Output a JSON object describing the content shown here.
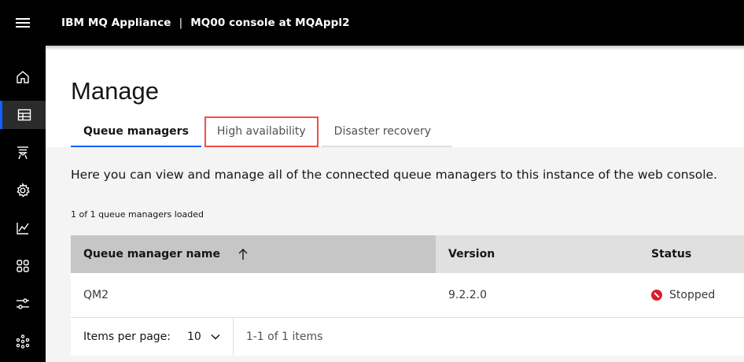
{
  "header": {
    "product": "IBM MQ Appliance",
    "separator": "|",
    "console": "MQ00 console at MQAppl2"
  },
  "sidebar": {
    "items": [
      {
        "icon": "home-icon"
      },
      {
        "icon": "table-icon",
        "active": true
      },
      {
        "icon": "queue-icon"
      },
      {
        "icon": "gear-icon"
      },
      {
        "icon": "chart-line-icon"
      },
      {
        "icon": "apps-icon"
      },
      {
        "icon": "sliders-icon"
      },
      {
        "icon": "network-icon"
      }
    ]
  },
  "page": {
    "title": "Manage",
    "tabs": [
      {
        "label": "Queue managers",
        "selected": true
      },
      {
        "label": "High availability"
      },
      {
        "label": "Disaster recovery"
      }
    ],
    "description": "Here you can view and manage all of the connected queue managers to this instance of the web console.",
    "loaded_text": "1 of 1 queue managers loaded"
  },
  "table": {
    "columns": [
      "Queue manager name",
      "Version",
      "Status"
    ],
    "rows": [
      {
        "name": "QM2",
        "version": "9.2.2.0",
        "status": "Stopped"
      }
    ]
  },
  "pagination": {
    "items_per_page_label": "Items per page:",
    "items_per_page_value": "10",
    "range_text": "1-1 of 1 items"
  },
  "colors": {
    "accent": "#0f62fe",
    "stopped": "#da1e28",
    "highlight": "#ef4f45"
  }
}
